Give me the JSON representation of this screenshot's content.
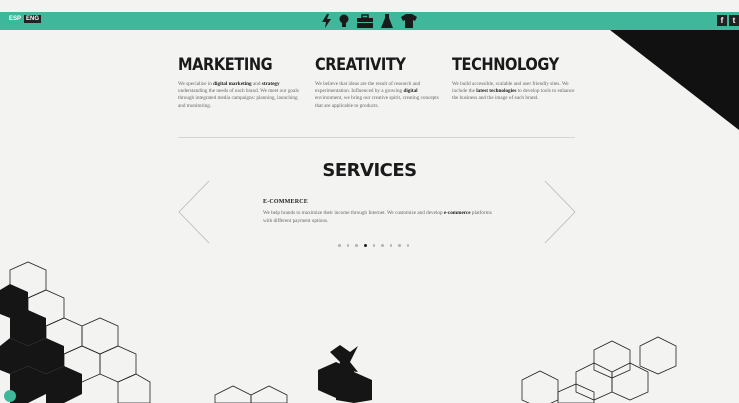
{
  "topbar": {
    "lang_esp": "ESP",
    "lang_eng": "ENG",
    "icons": [
      "lightning-icon",
      "lightbulb-icon",
      "briefcase-icon",
      "flask-icon",
      "tshirt-icon"
    ],
    "social": [
      "f",
      "t"
    ],
    "accent": "#3fb79b"
  },
  "columns": [
    {
      "title": "MARKETING",
      "text_html": "We specialize in <b>digital marketing</b> and <b>strategy</b> understanding the needs of each brand. We meet our goals through integrated media campaigns: planning, launching and monitoring."
    },
    {
      "title": "CREATIVITY",
      "text_html": "We believe that ideas are the result of research and experimentation. Influenced by a growing <b>digital</b> environment, we bring our creative spirit, creating concepts that are applicable to products."
    },
    {
      "title": "TECHNOLOGY",
      "text_html": "We build accessible, scalable and user friendly sites. We include the <b>latest technologies</b> to develop tools to enhance the business and the image of each brand."
    }
  ],
  "services": {
    "title": "SERVICES",
    "item_title": "E-COMMERCE",
    "item_text_html": "We help brands to maximize their income through Internet. We customize and develop <b>e-commerce</b> platforms with different payment options.",
    "slide_count": 9,
    "active_slide": 4
  }
}
